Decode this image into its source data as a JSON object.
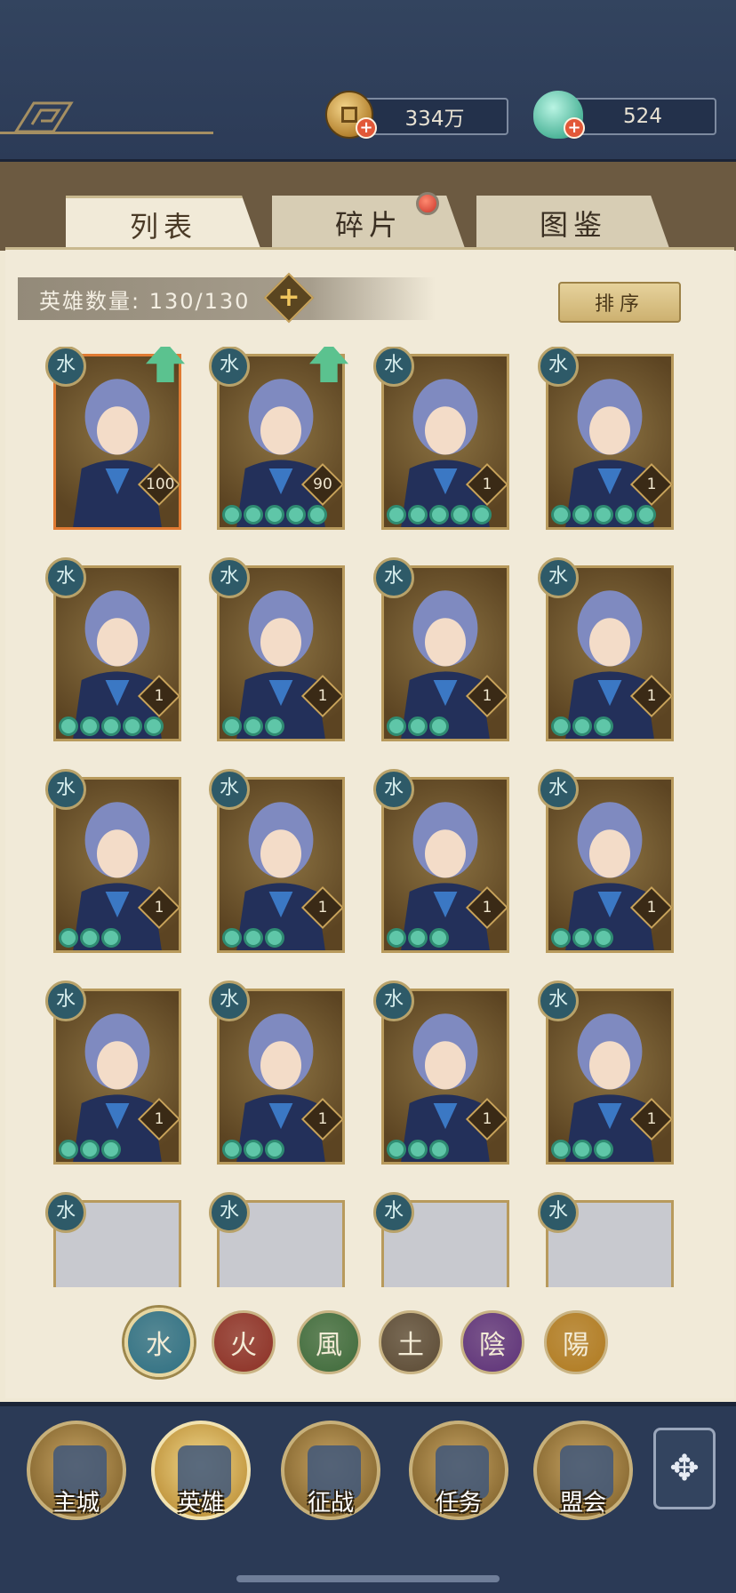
{
  "currencies": {
    "coins": "334万",
    "shells": "524"
  },
  "tabs": {
    "list": "列表",
    "fragments": "碎片",
    "codex": "图鉴"
  },
  "hero_count_label": "英雄数量: 130/130",
  "sort_label": "排序",
  "element_glyph": "水",
  "heroes": [
    {
      "level": "100",
      "stars": 0,
      "upgrade": true
    },
    {
      "level": "90",
      "stars": 5,
      "upgrade": true
    },
    {
      "level": "1",
      "stars": 5,
      "upgrade": false
    },
    {
      "level": "1",
      "stars": 5,
      "upgrade": false
    },
    {
      "level": "1",
      "stars": 5,
      "upgrade": false
    },
    {
      "level": "1",
      "stars": 3,
      "upgrade": false
    },
    {
      "level": "1",
      "stars": 3,
      "upgrade": false
    },
    {
      "level": "1",
      "stars": 3,
      "upgrade": false
    },
    {
      "level": "1",
      "stars": 3,
      "upgrade": false
    },
    {
      "level": "1",
      "stars": 3,
      "upgrade": false
    },
    {
      "level": "1",
      "stars": 3,
      "upgrade": false
    },
    {
      "level": "1",
      "stars": 3,
      "upgrade": false
    },
    {
      "level": "1",
      "stars": 3,
      "upgrade": false
    },
    {
      "level": "1",
      "stars": 3,
      "upgrade": false
    },
    {
      "level": "1",
      "stars": 3,
      "upgrade": false
    },
    {
      "level": "1",
      "stars": 3,
      "upgrade": false
    }
  ],
  "filters": [
    {
      "glyph": "水",
      "color": "#2e6f82",
      "selected": true
    },
    {
      "glyph": "火",
      "color": "#8c2f24",
      "selected": false
    },
    {
      "glyph": "風",
      "color": "#3e6a3a",
      "selected": false
    },
    {
      "glyph": "土",
      "color": "#5b4a34",
      "selected": false
    },
    {
      "glyph": "陰",
      "color": "#5d3178",
      "selected": false
    },
    {
      "glyph": "陽",
      "color": "#b07a1f",
      "selected": false
    }
  ],
  "nav": {
    "city": "主城",
    "heroes": "英雄",
    "battle": "征战",
    "quest": "任务",
    "alliance": "盟会"
  },
  "colors": {
    "accent_gold": "#c8a35b",
    "background_navy": "#2b3a56",
    "panel_parchment": "#f1ead8"
  }
}
